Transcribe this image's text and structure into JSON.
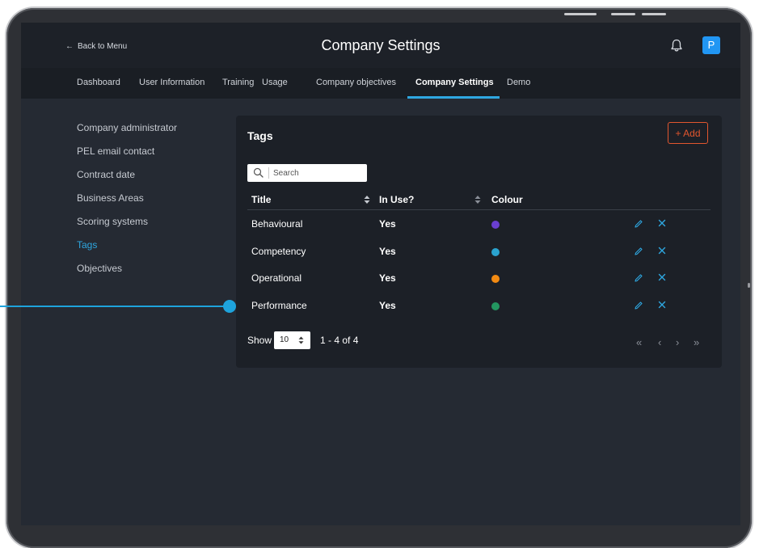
{
  "colors": {
    "accent": "#2ea7e0",
    "add_button": "#e2562e",
    "avatar": "#2196f3",
    "connector": "#1ea3dc"
  },
  "header": {
    "back_label": "Back to Menu",
    "back_icon": "arrow-left-icon",
    "title": "Company Settings",
    "bell_icon": "bell-icon",
    "avatar_initial": "P"
  },
  "tabs": [
    {
      "label": "Dashboard"
    },
    {
      "label": "User Information"
    },
    {
      "label": "Training"
    },
    {
      "label": "Usage"
    },
    {
      "label": "Company objectives"
    },
    {
      "label": "Company Settings",
      "active": true
    },
    {
      "label": "Demo"
    }
  ],
  "sidebar": {
    "items": [
      {
        "label": "Company administrator"
      },
      {
        "label": "PEL email contact"
      },
      {
        "label": "Contract date"
      },
      {
        "label": "Business Areas"
      },
      {
        "label": "Scoring systems"
      },
      {
        "label": "Tags",
        "active": true
      },
      {
        "label": "Objectives"
      }
    ]
  },
  "tags_card": {
    "title": "Tags",
    "add_label": "+ Add",
    "search_placeholder": "Search",
    "columns": {
      "title": "Title",
      "in_use": "In Use?",
      "colour": "Colour"
    },
    "rows": [
      {
        "title": "Behavioural",
        "in_use": "Yes",
        "colour": "#6a3fd0"
      },
      {
        "title": "Competency",
        "in_use": "Yes",
        "colour": "#2aa3cf"
      },
      {
        "title": "Operational",
        "in_use": "Yes",
        "colour": "#f28a12"
      },
      {
        "title": "Performance",
        "in_use": "Yes",
        "colour": "#239660"
      }
    ],
    "show_label": "Show",
    "page_size": "10",
    "range": "1 - 4 of 4",
    "pager": {
      "first": "«",
      "prev": "‹",
      "next": "›",
      "last": "»"
    }
  }
}
